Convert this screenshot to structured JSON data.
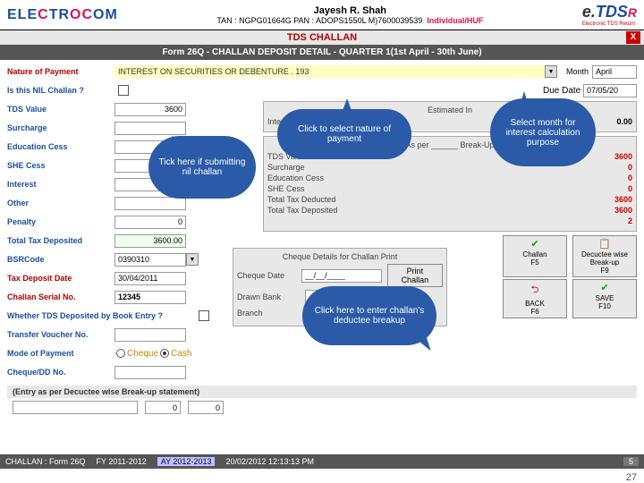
{
  "logo": "ELECTROCOM",
  "user": {
    "name": "Jayesh R. Shah",
    "info": "TAN : NGPG01664G PAN : ADOPS1550L  M)7600039539",
    "type": "Individual/HUF"
  },
  "etds": {
    "e": "e.",
    "t": "TDS",
    "r": "R",
    "sub": "Electronic TDS Return"
  },
  "title": "TDS CHALLAN",
  "subtitle": "Form 26Q - CHALLAN DEPOSIT DETAIL - QUARTER 1(1st April - 30th June)",
  "close": "X",
  "nop": {
    "label": "Nature of Payment",
    "value": "INTEREST ON SECURITIES OR DEBENTURE . 193"
  },
  "month": {
    "label": "Month",
    "value": "April"
  },
  "left": {
    "nil": {
      "label": "Is this NIL Challan ?"
    },
    "tds": {
      "label": "TDS Value",
      "value": "3600"
    },
    "sur": {
      "label": "Surcharge",
      "value": ""
    },
    "edu": {
      "label": "Education Cess",
      "value": ""
    },
    "she": {
      "label": "SHE Cess",
      "value": ""
    },
    "int": {
      "label": "Interest",
      "value": ""
    },
    "oth": {
      "label": "Other",
      "value": ""
    },
    "pen": {
      "label": "Penalty",
      "value": "0"
    },
    "tot": {
      "label": "Total Tax Deposited",
      "value": "3600.00"
    },
    "bsr": {
      "label": "BSRCode",
      "value": "0390310"
    },
    "tdd": {
      "label": "Tax Deposit Date",
      "value": "30/04/2011"
    },
    "csn": {
      "label": "Challan Serial No.",
      "value": "12345"
    },
    "book": {
      "label": "Whether TDS Deposited by Book Entry ?"
    },
    "tvn": {
      "label": "Transfer Voucher No.",
      "value": ""
    },
    "mode": {
      "label": "Mode of Payment",
      "o1": "Cheque",
      "o2": "Cash"
    },
    "chq": {
      "label": "Cheque/DD No.",
      "value": ""
    }
  },
  "right": {
    "due": {
      "label": "Due Date",
      "value": "07/05/20"
    },
    "est": {
      "title": "Estimated In",
      "int": {
        "label": "Interest",
        "value": "0.00"
      }
    },
    "breakup": {
      "title": "(As per ______ Break-Up)",
      "tds": {
        "label": "TDS Value",
        "value": "3600"
      },
      "sur": {
        "label": "Surcharge",
        "value": "0"
      },
      "edu": {
        "label": "Education Cess",
        "value": "0"
      },
      "she": {
        "label": "SHE Cess",
        "value": "0"
      },
      "ttd": {
        "label": "Total Tax Deducted",
        "value": "3600"
      },
      "ttp": {
        "label": "Total Tax Deposited",
        "value": "3600"
      },
      "cnt": {
        "label": "",
        "value": "2"
      }
    },
    "dw": {
      "label": "Decuctee wise Break-up",
      "key": "F9"
    }
  },
  "cheque": {
    "title": "Cheque Details for Challan Print",
    "date": {
      "label": "Cheque Date",
      "value": "__/__/____"
    },
    "bank": {
      "label": "Drawn Bank",
      "value": ""
    },
    "branch": {
      "label": "Branch",
      "value": ""
    },
    "print": "Print Challan"
  },
  "fbtns": {
    "challan": {
      "t": "Challan",
      "k": "F5"
    },
    "back": {
      "t": "BACK",
      "k": "F6"
    },
    "save": {
      "t": "SAVE",
      "k": "F10"
    }
  },
  "entry": "(Entry as per Decuctee wise Break-up statement)",
  "bot": {
    "l1": "",
    "l2": "0",
    "l3": "0"
  },
  "status": {
    "form": "CHALLAN : Form 26Q",
    "fy": "FY 2011-2012",
    "ay": "AY 2012-2013",
    "dt": "20/02/2012 12:13:13 PM",
    "n": "5"
  },
  "callouts": {
    "c1": "Click to select nature of payment",
    "c2": "Tick here if submitting nil challan",
    "c3": "Select month for interest calculation purpose",
    "c4": "Click here to enter challan's deductee breakup"
  },
  "page": "27"
}
